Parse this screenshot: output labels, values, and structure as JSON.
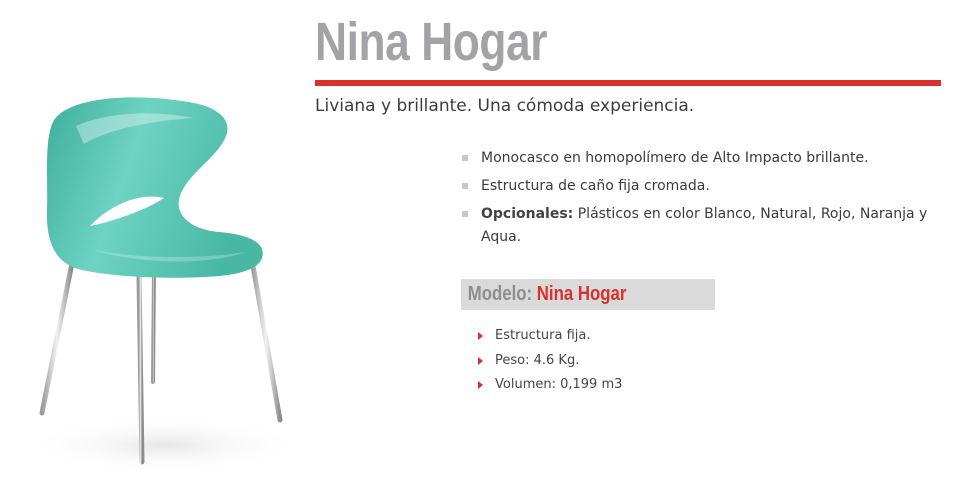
{
  "product": {
    "title": "Nina Hogar",
    "subtitle": "Liviana y brillante. Una cómoda experiencia.",
    "image_alt": "chair-icon"
  },
  "features": [
    {
      "bold": "",
      "text": "Monocasco en homopolímero de Alto Impacto brillante."
    },
    {
      "bold": "",
      "text": "Estructura de caño fija cromada."
    },
    {
      "bold": "Opcionales:",
      "text": " Plásticos en color Blanco, Natural, Rojo, Naranja y Aqua."
    }
  ],
  "model": {
    "label": "Modelo:",
    "name": "Nina Hogar",
    "specs": [
      "Estructura fija.",
      "Peso: 4.6 Kg.",
      "Volumen: 0,199 m3"
    ]
  },
  "colors": {
    "accent": "#d8302d",
    "title": "#a3a3a7",
    "seat": "#5cc6b3",
    "model_bar_bg": "#dadada"
  }
}
